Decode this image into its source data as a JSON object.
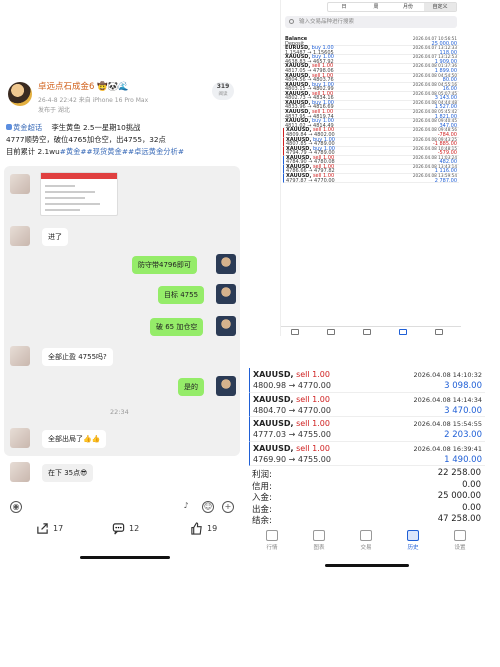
{
  "post": {
    "username": "卓远点石成金6",
    "emoji": "🤠🐼🌊",
    "meta": "26-4-8 22:42 来自 iPhone 16 Pro Max",
    "location": "发布于 湖北",
    "views": "319",
    "views_label": "阅读",
    "topic": "黄金超话",
    "line1": "李生黄鱼 2.5一星期10挑战",
    "line2": "4777顺势空，破位4765加仓空，出4755，32点",
    "line3_a": "目前累计 2.1wu",
    "line3_tags": "#黄金##现货黄金##卓远黄金分析#",
    "comments": "17",
    "messages": "12",
    "likes": "19"
  },
  "chat": {
    "msg1": "进了",
    "msg2": "防守带4796即可",
    "msg3": "目标 4755",
    "msg4": "破 65 加仓空",
    "msg5": "全部止盈 4755吗?",
    "msg6": "是的",
    "time": "22:34",
    "msg7": "全部出局了👍👍",
    "msg8": "在下 35点😎"
  },
  "mt_top": {
    "segments": [
      "日",
      "周",
      "月份",
      "自定义"
    ],
    "search_placeholder": "输入交易品种进行搜索",
    "rows": [
      {
        "l1a": "Balance",
        "l1b": "",
        "l2": "Deposit",
        "t": "2026.04.07 10:56:51",
        "v": "25 000.00",
        "vc": "b",
        "line": ""
      },
      {
        "l1a": "EURUSD,",
        "l1b": "buy 1.00",
        "l2": "1.15487 → 1.15605",
        "t": "2026.04.07 13:12:33",
        "v": "118.00",
        "vc": "b",
        "line": ""
      },
      {
        "l1a": "XAUUSD,",
        "l1b": "buy 1.00",
        "l2": "4638.83 → 4657.92",
        "t": "2026.04.07 13:12:53",
        "v": "1 909.00",
        "vc": "b",
        "line": ""
      },
      {
        "l1a": "XAUUSD,",
        "l1b": "sell 1.00",
        "l2": "4817.05 → 4798.06",
        "t": "2026.04.08 01:37:36",
        "v": "1 899.00",
        "vc": "b",
        "line": ""
      },
      {
        "l1a": "XAUUSD,",
        "l1b": "sell 1.00",
        "l2": "4804.56 → 4803.76",
        "t": "2026.04.08 04:54:50",
        "v": "80.00",
        "vc": "b",
        "line": ""
      },
      {
        "l1a": "XAUUSD,",
        "l1b": "buy 1.00",
        "l2": "4803.15 → 4802.99",
        "t": "2026.04.08 04:55:16",
        "v": "16.00",
        "vc": "b",
        "line": ""
      },
      {
        "l1a": "XAUUSD,",
        "l1b": "sell 1.00",
        "l2": "4802.73 → 4834.16",
        "t": "2026.04.08 05:07:45",
        "v": "3 143.00",
        "vc": "b",
        "line": ""
      },
      {
        "l1a": "XAUUSD,",
        "l1b": "buy 1.00",
        "l2": "4833.96 → 4816.69",
        "t": "2026.04.08 04:44:48",
        "v": "1 527.00",
        "vc": "b",
        "line": ""
      },
      {
        "l1a": "XAUUSD,",
        "l1b": "sell 1.00",
        "l2": "4837.95 → 4819.74",
        "t": "2026.04.08 05:45:42",
        "v": "1 821.00",
        "vc": "b",
        "line": ""
      },
      {
        "l1a": "XAUUSD,",
        "l1b": "buy 1.00",
        "l2": "4811.02 → 4814.49",
        "t": "2026.04.08 09:40:45",
        "v": "347.00",
        "vc": "b",
        "line": ""
      },
      {
        "l1a": "XAUUSD,",
        "l1b": "sell 1.00",
        "l2": "4809.84 → 4802.00",
        "t": "2026.04.08 09:48:56",
        "v": "-784.00",
        "vc": "r",
        "line": "rl"
      },
      {
        "l1a": "XAUUSD,",
        "l1b": "buy 1.00",
        "l2": "4807.85 → 4789.00",
        "t": "2026.04.08 09:43:25",
        "v": "-1 885.00",
        "vc": "r",
        "line": "rl"
      },
      {
        "l1a": "XAUUSD,",
        "l1b": "buy 1.00",
        "l2": "4794.79 → 4789.00",
        "t": "2026.04.08 10:48:15",
        "v": "-579.00",
        "vc": "r",
        "line": "rl"
      },
      {
        "l1a": "XAUUSD,",
        "l1b": "sell 1.00",
        "l2": "4784.90 → 4780.08",
        "t": "2026.04.08 11:03:24",
        "v": "482.00",
        "vc": "b",
        "line": "bl"
      },
      {
        "l1a": "XAUUSD,",
        "l1b": "sell 1.00",
        "l2": "4786.66 → 4797.82",
        "t": "2026.04.08 13:43:14",
        "v": "1 116.00",
        "vc": "b",
        "line": "bl"
      },
      {
        "l1a": "XAUUSD,",
        "l1b": "sell 1.00",
        "l2": "4797.87 → 4770.00",
        "t": "2026.04.08 13:59:54",
        "v": "2 787.00",
        "vc": "b",
        "line": "bl"
      }
    ]
  },
  "mt_bottom": {
    "orders": [
      {
        "sym": "XAUUSD,",
        "side": "sell 1.00",
        "px": "4800.98 → 4770.00",
        "t": "2026.04.08 14:10:32",
        "v": "3 098.00"
      },
      {
        "sym": "XAUUSD,",
        "side": "sell 1.00",
        "px": "4804.70 → 4770.00",
        "t": "2026.04.08 14:14:34",
        "v": "3 470.00"
      },
      {
        "sym": "XAUUSD,",
        "side": "sell 1.00",
        "px": "4777.03 → 4755.00",
        "t": "2026.04.08 15:54:55",
        "v": "2 203.00"
      },
      {
        "sym": "XAUUSD,",
        "side": "sell 1.00",
        "px": "4769.90 → 4755.00",
        "t": "2026.04.08 16:39:41",
        "v": "1 490.00"
      }
    ],
    "summary": [
      {
        "k": "利润:",
        "v": "22 258.00"
      },
      {
        "k": "信用:",
        "v": "0.00"
      },
      {
        "k": "入金:",
        "v": "25 000.00"
      },
      {
        "k": "出金:",
        "v": "0.00"
      },
      {
        "k": "结余:",
        "v": "47 258.00"
      }
    ],
    "tabs": [
      "行情",
      "图表",
      "交易",
      "历史",
      "设置"
    ]
  },
  "colors": {
    "buy_blue": "#1f5fd6",
    "loss_red": "#d02020",
    "wechat_green": "#95ec69",
    "username_orange": "#d0601a"
  }
}
